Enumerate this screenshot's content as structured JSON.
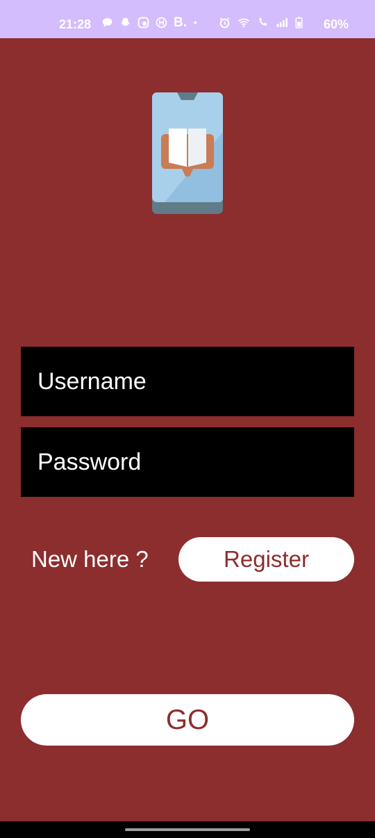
{
  "status_bar": {
    "time": "21:28",
    "battery": "60%",
    "left_icons": [
      "chat-bubble-icon",
      "snapchat-icon",
      "messenger-icon",
      "h-badge-icon",
      "b-letter-icon",
      "dot-icon"
    ],
    "right_icons": [
      "alarm-icon",
      "wifi-icon",
      "wifi-calling-icon",
      "signal-icon",
      "battery-icon"
    ],
    "b_letter": "B.",
    "background": "#d3bdfc"
  },
  "logo": {
    "icon": "phone-book-icon"
  },
  "login": {
    "username_placeholder": "Username",
    "password_placeholder": "Password",
    "new_here_label": "New here ?",
    "register_label": "Register",
    "go_label": "GO"
  },
  "colors": {
    "background": "#8c2d2e",
    "field_background": "#000000",
    "button_background": "#ffffff",
    "button_text": "#8c2d2e"
  }
}
